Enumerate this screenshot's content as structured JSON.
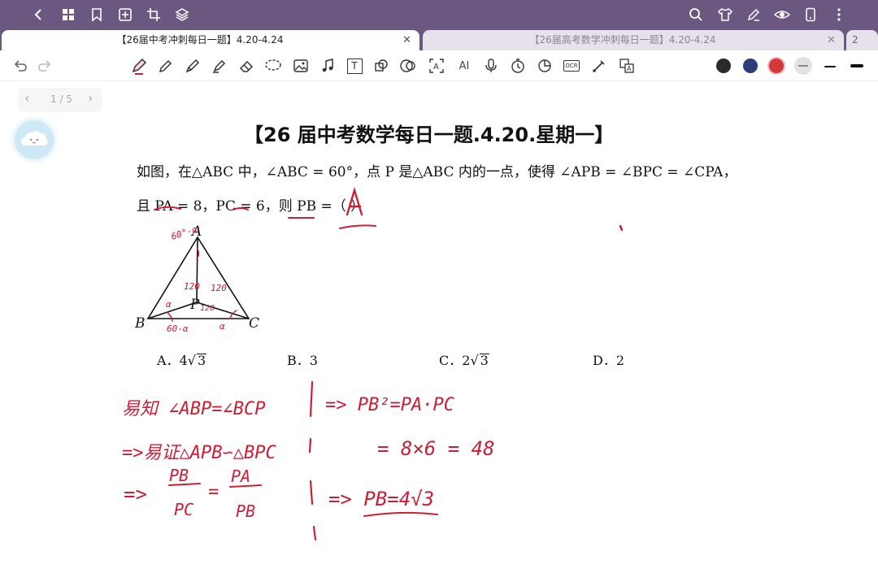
{
  "toolbar_top": {
    "icons": [
      "back-icon",
      "grid-icon",
      "bookmark-icon",
      "add-page-icon",
      "crop-icon",
      "layers-icon",
      "search-icon",
      "shirt-icon",
      "pen-icon",
      "eye-icon",
      "phone-icon",
      "more-icon"
    ]
  },
  "tabs": [
    {
      "label": "【26届中考冲刺每日一题】4.20-4.24",
      "close": "✕"
    },
    {
      "label": "【26届高考数学冲刺每日一题】4.20-4.24",
      "close": "✕"
    },
    {
      "label": "2"
    }
  ],
  "tools": {
    "text_tool": "T",
    "ocr_label": "OCR",
    "ai_label": "AI",
    "colors": [
      "#2a2a2a",
      "#2c3e78",
      "#d23a3a",
      "#dddddd"
    ]
  },
  "pager": {
    "prev": "‹",
    "label": "1 / 5",
    "next": "›"
  },
  "document": {
    "title": "【26 届中考数学每日一题.4.20.星期一】",
    "question": {
      "line1": "如图，在△ABC 中，∠ABC = 60°，点 P 是△ABC 内的一点，使得 ∠APB = ∠BPC = ∠CPA，",
      "line2": "且 PA = 8，PC = 6，则 PB =（        ）"
    },
    "figure": {
      "labels": {
        "A": "A",
        "B": "B",
        "C": "C",
        "P": "P"
      }
    },
    "choices": [
      {
        "letter": "A．",
        "value": "4",
        "radical": "3"
      },
      {
        "letter": "B．",
        "value": "3",
        "radical": ""
      },
      {
        "letter": "C．",
        "value": "2",
        "radical": "3"
      },
      {
        "letter": "D．",
        "value": "2",
        "radical": ""
      }
    ]
  },
  "handwriting": {
    "color": "#cc1f35",
    "answer": "A",
    "figure_notes": [
      "60°-α",
      "α",
      "120",
      "120",
      "120",
      "60-α",
      "α"
    ],
    "left_col": [
      "易知 ∠ABP=∠BCP",
      "=>易证△APB∽△BPC",
      "=>",
      "PB",
      "PC",
      "=",
      "PA",
      "PB"
    ],
    "right_col": [
      "=> PB²=PA·PC",
      "= 8×6 = 48",
      "=> PB=4√3"
    ]
  }
}
